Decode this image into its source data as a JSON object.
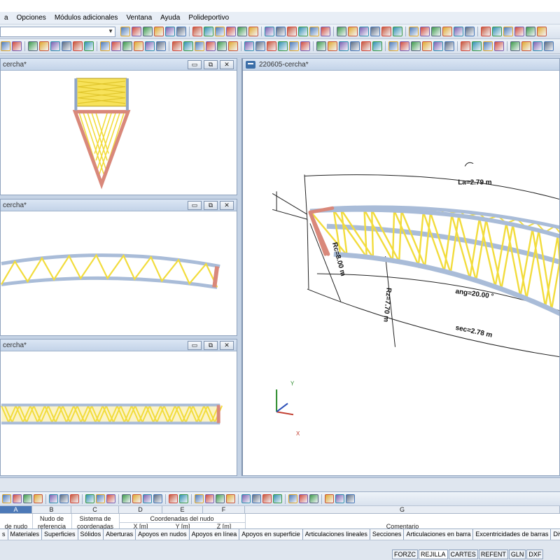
{
  "menu": {
    "items": [
      "a",
      "Opciones",
      "Módulos adicionales",
      "Ventana",
      "Ayuda",
      "Polideportivo"
    ]
  },
  "windows": {
    "front": {
      "title": "cercha*"
    },
    "plan": {
      "title": "cercha*"
    },
    "side": {
      "title": "cercha*"
    },
    "main3d": {
      "title": "220605-cercha*"
    }
  },
  "window_buttons": {
    "minimize": "▭",
    "restore": "⧉",
    "close": "✕"
  },
  "dimensions": {
    "la": "La=2.79 m",
    "rc": "Rc=8.00 m",
    "rz": "Rz=7.70 m",
    "ang": "ang=20.00 °",
    "sec": "sec=2.78 m"
  },
  "axes": {
    "y": "Y",
    "x": "X"
  },
  "grid": {
    "columns": [
      "A",
      "B",
      "C",
      "D",
      "E",
      "F",
      "G"
    ],
    "headers": {
      "b": "Nudo de",
      "b2": "referencia",
      "c": "Sistema de",
      "c2": "coordenadas",
      "coords": "Coordenadas del nudo",
      "a": "de nudo",
      "x": "X [m]",
      "y": "Y [m]",
      "z": "Z [m]",
      "g": "Comentario"
    }
  },
  "sheet_tabs": [
    "s",
    "Materiales",
    "Superficies",
    "Sólidos",
    "Aberturas",
    "Apoyos en nudos",
    "Apoyos en línea",
    "Apoyos en superficie",
    "Articulaciones lineales",
    "Secciones",
    "Articulaciones en barra",
    "Excentricidades de barras",
    "Divisiones de barras"
  ],
  "status": [
    "FORZC",
    "REJILLA",
    "CARTES",
    "REFENT",
    "GLN",
    "DXF"
  ],
  "colors": {
    "truss_diagonal": "#f2dc3c",
    "truss_chord": "#a9bcd8",
    "end_member": "#d9887a",
    "accent": "#4d79b7"
  }
}
